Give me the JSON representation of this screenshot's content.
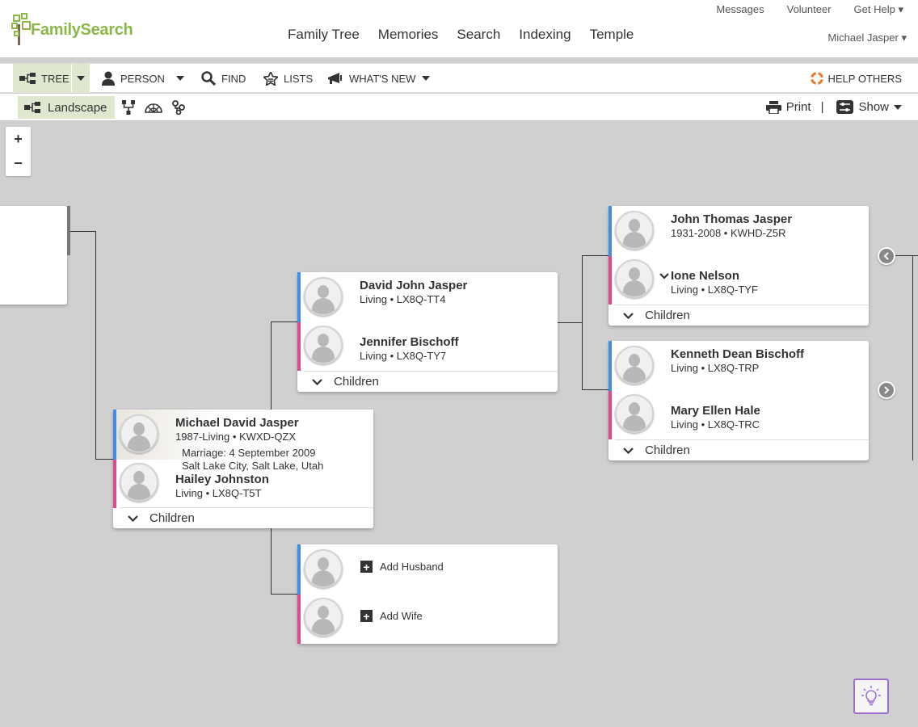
{
  "header": {
    "logo_text": "FamilySearch",
    "nav": [
      "Family Tree",
      "Memories",
      "Search",
      "Indexing",
      "Temple"
    ],
    "util": [
      "Messages",
      "Volunteer",
      "Get Help ▾"
    ],
    "user": "Michael Jasper ▾"
  },
  "toolbar": {
    "tree": "TREE",
    "person": "PERSON",
    "find": "FIND",
    "lists": "LISTS",
    "whats_new": "WHAT'S NEW",
    "help_others": "HELP OTHERS"
  },
  "viewbar": {
    "landscape": "Landscape",
    "print": "Print",
    "separator": "|",
    "show": "Show"
  },
  "zoom": {
    "in": "+",
    "out": "−"
  },
  "couples": {
    "main": {
      "husband": {
        "name": "Michael David Jasper",
        "detail": "1987-Living • KWXD-QZX"
      },
      "marriage_line1": "Marriage: 4 September 2009",
      "marriage_line2": "Salt Lake City, Salt Lake, Utah",
      "wife": {
        "name": "Hailey Johnston",
        "detail": "Living • LX8Q-T5T"
      },
      "children": "Children"
    },
    "parents": {
      "husband": {
        "name": "David John Jasper",
        "detail": "Living • LX8Q-TT4"
      },
      "wife": {
        "name": "Jennifer Bischoff",
        "detail": "Living • LX8Q-TY7"
      },
      "children": "Children"
    },
    "in_laws": {
      "add_husband": "Add Husband",
      "add_wife": "Add Wife"
    },
    "grandparents_paternal": {
      "husband": {
        "name": "John Thomas Jasper",
        "detail": "1931-2008 • KWHD-Z5R"
      },
      "wife": {
        "name": "Ione Nelson",
        "detail": "Living • LX8Q-TYF"
      },
      "children": "Children"
    },
    "grandparents_maternal": {
      "husband": {
        "name": "Kenneth Dean Bischoff",
        "detail": "Living • LX8Q-TRP"
      },
      "wife": {
        "name": "Mary Ellen Hale",
        "detail": "Living • LX8Q-TRC"
      },
      "children": "Children"
    }
  },
  "colors": {
    "brand_green": "#8cb84a",
    "male_accent": "#3d8ee4",
    "female_accent": "#e0498f",
    "selected_bg": "#dfe8cf"
  }
}
